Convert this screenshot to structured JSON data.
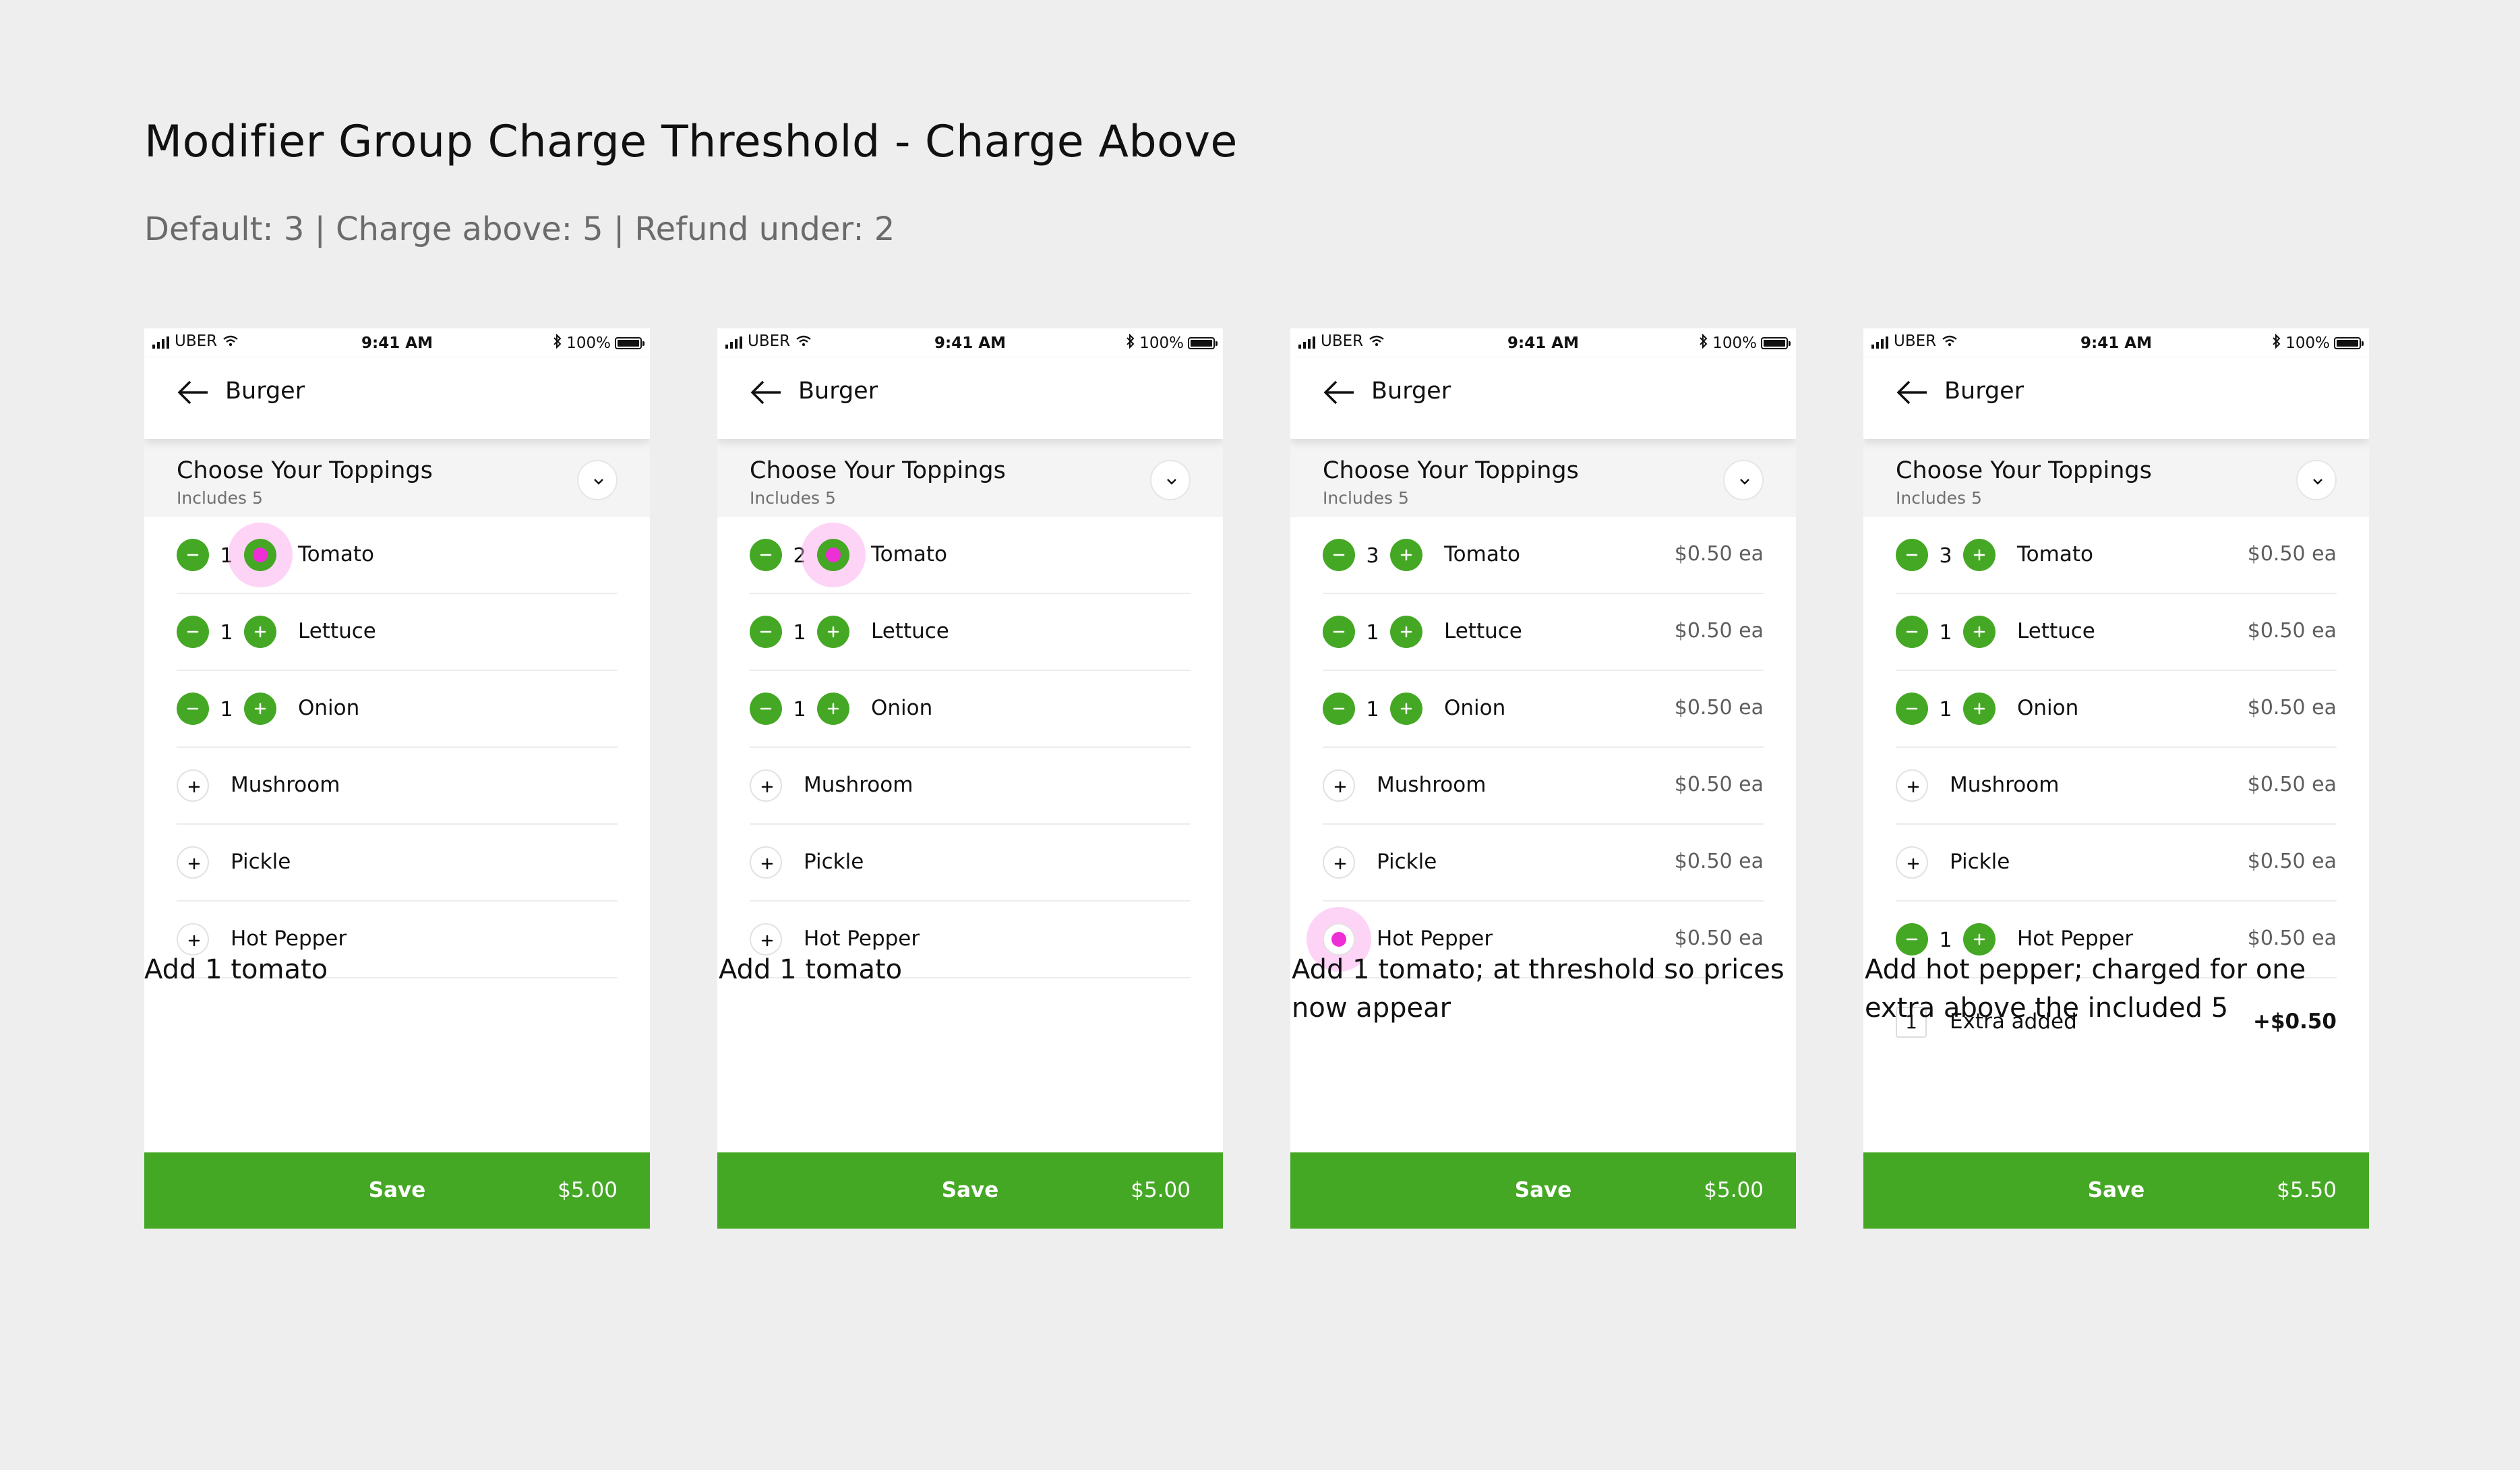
{
  "page": {
    "title": "Modifier Group Charge Threshold - Charge Above",
    "subtitle": "Default: 3  |  Charge above: 5  |  Refund under: 2"
  },
  "status": {
    "carrier": "UBER",
    "time": "9:41 AM",
    "battery": "100%",
    "wifi_icon": "wifi-icon",
    "bluetooth_icon": "bluetooth-icon"
  },
  "nav": {
    "title": "Burger",
    "back_icon": "arrow-left-icon"
  },
  "group": {
    "title": "Choose Your Toppings",
    "subtitle": "Includes 5",
    "collapse_icon": "chevron-down-icon"
  },
  "save_label": "Save",
  "colors": {
    "accent": "#45a825",
    "background": "#eeeeee",
    "tap_indicator": "#ee2fd5"
  },
  "screens": [
    {
      "caption": "Add 1 tomato",
      "total": "$5.00",
      "toppings": [
        {
          "name": "Tomato",
          "qty": "1",
          "price": "",
          "tapped": true
        },
        {
          "name": "Lettuce",
          "qty": "1",
          "price": ""
        },
        {
          "name": "Onion",
          "qty": "1",
          "price": ""
        },
        {
          "name": "Mushroom",
          "qty": "",
          "price": ""
        },
        {
          "name": "Pickle",
          "qty": "",
          "price": ""
        },
        {
          "name": "Hot Pepper",
          "qty": "",
          "price": ""
        }
      ]
    },
    {
      "caption": "Add 1 tomato",
      "total": "$5.00",
      "toppings": [
        {
          "name": "Tomato",
          "qty": "2",
          "price": "",
          "tapped": true
        },
        {
          "name": "Lettuce",
          "qty": "1",
          "price": ""
        },
        {
          "name": "Onion",
          "qty": "1",
          "price": ""
        },
        {
          "name": "Mushroom",
          "qty": "",
          "price": ""
        },
        {
          "name": "Pickle",
          "qty": "",
          "price": ""
        },
        {
          "name": "Hot Pepper",
          "qty": "",
          "price": ""
        }
      ]
    },
    {
      "caption": "Add 1 tomato; at threshold so prices now appear",
      "total": "$5.00",
      "toppings": [
        {
          "name": "Tomato",
          "qty": "3",
          "price": "$0.50 ea"
        },
        {
          "name": "Lettuce",
          "qty": "1",
          "price": "$0.50 ea"
        },
        {
          "name": "Onion",
          "qty": "1",
          "price": "$0.50 ea"
        },
        {
          "name": "Mushroom",
          "qty": "",
          "price": "$0.50 ea"
        },
        {
          "name": "Pickle",
          "qty": "",
          "price": "$0.50 ea"
        },
        {
          "name": "Hot Pepper",
          "qty": "",
          "price": "$0.50 ea",
          "tapped": true
        }
      ]
    },
    {
      "caption": "Add hot pepper; charged for one extra above the included 5",
      "total": "$5.50",
      "toppings": [
        {
          "name": "Tomato",
          "qty": "3",
          "price": "$0.50 ea"
        },
        {
          "name": "Lettuce",
          "qty": "1",
          "price": "$0.50 ea"
        },
        {
          "name": "Onion",
          "qty": "1",
          "price": "$0.50 ea"
        },
        {
          "name": "Mushroom",
          "qty": "",
          "price": "$0.50 ea"
        },
        {
          "name": "Pickle",
          "qty": "",
          "price": "$0.50 ea"
        },
        {
          "name": "Hot Pepper",
          "qty": "1",
          "price": "$0.50 ea"
        }
      ],
      "extra": {
        "count": "1",
        "label": "Extra added",
        "amount": "+$0.50"
      }
    }
  ]
}
